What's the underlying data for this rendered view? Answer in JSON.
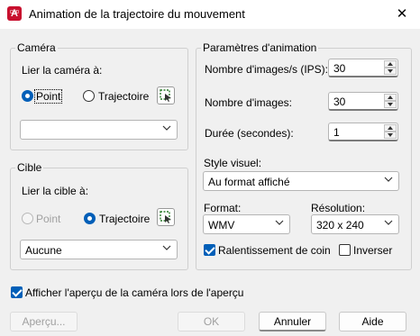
{
  "window": {
    "title": "Animation de la trajectoire du mouvement",
    "app_icon_letter": "A",
    "app_icon_sub": "CAD"
  },
  "camera": {
    "legend": "Caméra",
    "link_label": "Lier la caméra à:",
    "point_label": "Point",
    "path_label": "Trajectoire",
    "selected": "point",
    "combo_value": ""
  },
  "target": {
    "legend": "Cible",
    "link_label": "Lier la cible à:",
    "point_label": "Point",
    "path_label": "Trajectoire",
    "selected": "path",
    "combo_value": "Aucune"
  },
  "animation": {
    "legend": "Paramètres d'animation",
    "fps_label": "Nombre d'images/s (IPS):",
    "fps_value": "30",
    "frames_label": "Nombre d'images:",
    "frames_value": "30",
    "duration_label": "Durée (secondes):",
    "duration_value": "1",
    "visual_style_label": "Style visuel:",
    "visual_style_value": "Au format affiché",
    "format_label": "Format:",
    "format_value": "WMV",
    "resolution_label": "Résolution:",
    "resolution_value": "320 x 240",
    "slowdown_label": "Ralentissement de coin",
    "slowdown_checked": true,
    "reverse_label": "Inverser",
    "reverse_checked": false
  },
  "preview_checkbox_label": "Afficher l'aperçu de la caméra lors de l'aperçu",
  "preview_checkbox_checked": true,
  "buttons": {
    "preview": "Aperçu...",
    "ok": "OK",
    "cancel": "Annuler",
    "help": "Aide"
  },
  "colors": {
    "accent": "#005fb8",
    "app_icon": "#c8102e"
  }
}
